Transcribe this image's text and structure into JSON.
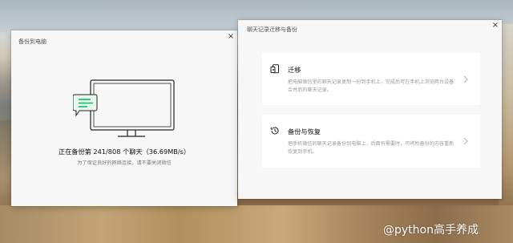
{
  "backup_window": {
    "title": "备份到电脑",
    "close_glyph": "×",
    "progress_text": "正在备份第 241/808 个聊天（36.69MB/s）",
    "hint_text": "为了保证良好的网络连接，请不要关闭微信",
    "illustration_icon": "monitor-chat-icon",
    "accent_color": "#07c160"
  },
  "migrate_window": {
    "title": "聊天记录迁移与备份",
    "close_glyph": "×",
    "options": [
      {
        "icon": "phone-transfer-icon",
        "title": "迁移",
        "description": "把电脑微信里的聊天记录复制一份到手机上，完成后可在手机上浏览两台设备合并后的聊天记录。"
      },
      {
        "icon": "history-clock-icon",
        "title": "备份与恢复",
        "description": "把手机微信的聊天记录备份到电脑上，后面有需要时，可将所备份的内容重新恢复到手机。"
      }
    ]
  },
  "watermark": {
    "text": "@python高手养成"
  }
}
